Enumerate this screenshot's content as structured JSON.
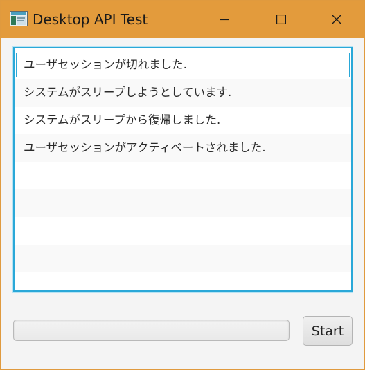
{
  "window": {
    "title": "Desktop API Test",
    "accent_color": "#e39b3c",
    "controls": [
      "minimize-icon",
      "maximize-icon",
      "close-icon"
    ]
  },
  "list": {
    "items": [
      "ユーザセッションが切れました.",
      "システムがスリープしようとしています.",
      "システムがスリープから復帰しました.",
      "ユーザセッションがアクティベートされました."
    ],
    "selected_index": 0,
    "empty_rows": 5,
    "focus_color": "#2aa8d8"
  },
  "progress": {
    "value": 0
  },
  "buttons": {
    "start_label": "Start"
  }
}
